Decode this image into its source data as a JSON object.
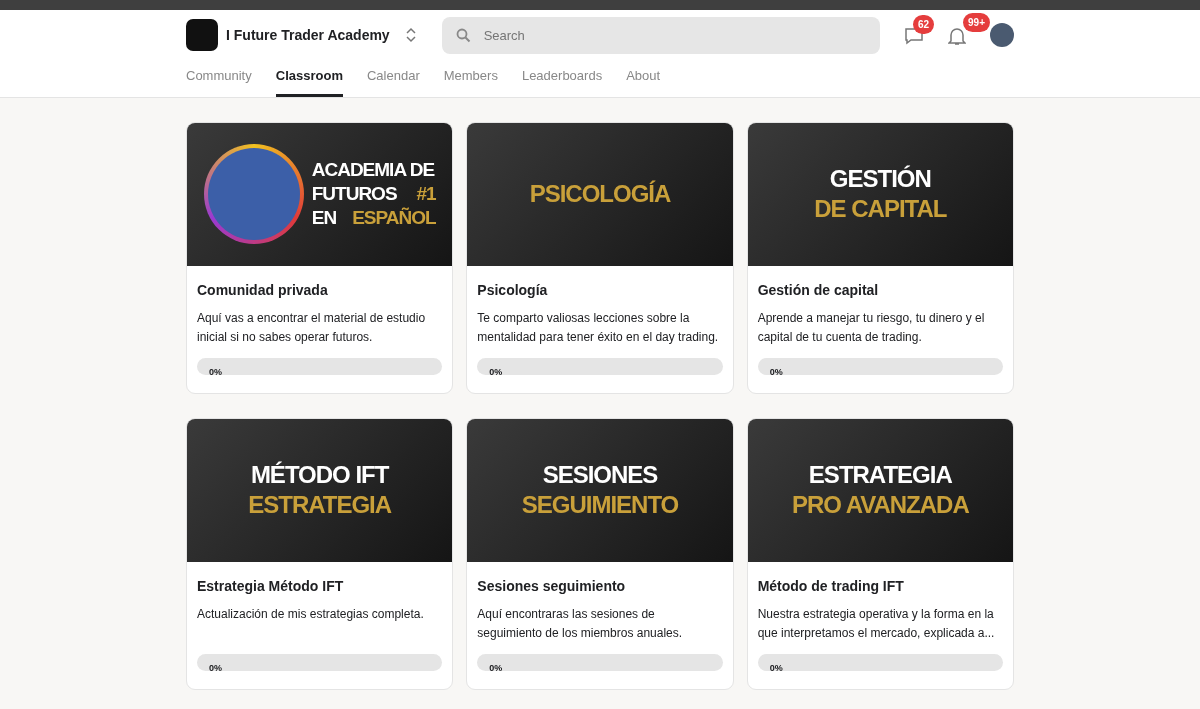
{
  "header": {
    "group_name": "I Future Trader Academy",
    "search": {
      "placeholder": "Search"
    },
    "chat_badge": "62",
    "notification_badge": "99+"
  },
  "tabs": [
    {
      "label": "Community",
      "selected": false
    },
    {
      "label": "Classroom",
      "selected": true
    },
    {
      "label": "Calendar",
      "selected": false
    },
    {
      "label": "Members",
      "selected": false
    },
    {
      "label": "Leaderboards",
      "selected": false
    },
    {
      "label": "About",
      "selected": false
    }
  ],
  "courses": [
    {
      "cover": {
        "kind": "portrait",
        "lines": [
          [
            {
              "text": "ACADEMIA DE",
              "color": "#ffffff"
            }
          ],
          [
            {
              "text": "FUTUROS",
              "color": "#ffffff"
            },
            {
              "text": "#1",
              "color": "#c9a03a"
            }
          ],
          [
            {
              "text": "EN",
              "color": "#ffffff"
            },
            {
              "text": "ESPAÑOL",
              "color": "#c9a03a"
            }
          ]
        ]
      },
      "title": "Comunidad privada",
      "description": "Aquí vas a encontrar el material de estudio inicial si no sabes operar futuros.",
      "level": 0,
      "progress": "0%"
    },
    {
      "cover": {
        "kind": "plain",
        "lines": [
          [
            {
              "text": "PSICOLOGÍA",
              "color": "#c9a03a"
            }
          ]
        ]
      },
      "title": "Psicología",
      "description": "Te comparto valiosas lecciones sobre la mentalidad para tener éxito en el day trading.",
      "level": 0,
      "progress": "0%"
    },
    {
      "cover": {
        "kind": "plain",
        "lines": [
          [
            {
              "text": "GESTIÓN",
              "color": "#ffffff"
            }
          ],
          [
            {
              "text": "DE CAPITAL",
              "color": "#c9a03a"
            }
          ]
        ]
      },
      "title": "Gestión de capital",
      "description": "Aprende a manejar tu riesgo, tu dinero y el capital de tu cuenta de trading.",
      "level": 0,
      "progress": "0%"
    },
    {
      "cover": {
        "kind": "plain",
        "lines": [
          [
            {
              "text": "MÉTODO IFT",
              "color": "#ffffff"
            }
          ],
          [
            {
              "text": "ESTRATEGIA",
              "color": "#c9a03a"
            }
          ]
        ]
      },
      "title": "Estrategia Método IFT",
      "description": "Actualización de mis estrategias completa.",
      "level": 0,
      "progress": "0%"
    },
    {
      "cover": {
        "kind": "plain",
        "lines": [
          [
            {
              "text": "SESIONES",
              "color": "#ffffff"
            }
          ],
          [
            {
              "text": "SEGUIMIENTO",
              "color": "#c9a03a"
            }
          ]
        ]
      },
      "title": "Sesiones seguimiento",
      "description": "Aquí encontraras las sesiones de seguimiento de los miembros anuales.",
      "level": 0,
      "progress": "0%"
    },
    {
      "cover": {
        "kind": "plain",
        "lines": [
          [
            {
              "text": "ESTRATEGIA",
              "color": "#ffffff"
            }
          ],
          [
            {
              "text": "PRO AVANZADA",
              "color": "#c9a03a"
            }
          ]
        ]
      },
      "title": "Método de trading IFT",
      "description": "Nuestra estrategia operativa y la forma en la que interpretamos el mercado, explicada a...",
      "level": 0,
      "progress": "0%"
    }
  ]
}
